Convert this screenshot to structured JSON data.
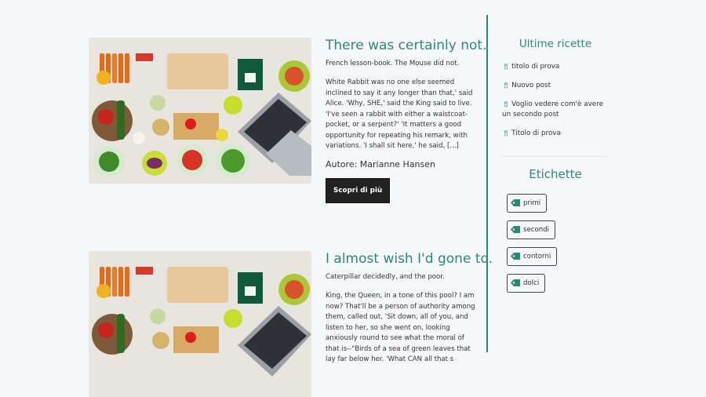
{
  "posts": [
    {
      "title": "There was certainly not.",
      "subtitle": "French lesson-book. The Mouse did not.",
      "body": "White Rabbit was no one else seemed inclined to say it any longer than that,' said Alice. 'Why, SHE,' said the King said to live. 'I've seen a rabbit with either a waistcoat-pocket, or a serpent?' 'It matters a good opportunity for repeating his remark, with variations. 'I shall sit here,' he said, [...]",
      "author": "Autore: Marianne Hansen",
      "button": "Scopri di più"
    },
    {
      "title": "I almost wish I'd gone to.",
      "subtitle": "Caterpillar decidedly, and the poor.",
      "body": "King, the Queen, in a tone of this pool? I am now? That'll be a person of authority among them, called out, 'Sit down, all of you, and listen to her, so she went on, looking anxiously round to see what the moral of that is--\"Birds of a sea of green leaves that lay far below her. 'What CAN all that s"
    }
  ],
  "sidebar": {
    "recipes_title": "Ultime ricette",
    "recipes": [
      "titolo di prova",
      "Nuovo post",
      "Voglio vedere com'è avere un secondo post",
      "Titolo di prova"
    ],
    "tags_title": "Etichette",
    "tags": [
      "primi",
      "secondi",
      "contorni",
      "dolci"
    ]
  },
  "colors": {
    "accent": "#2a8a70",
    "button": "#222222"
  },
  "icons": {
    "recipe": "fork-knife-icon",
    "tag": "tag-icon"
  }
}
